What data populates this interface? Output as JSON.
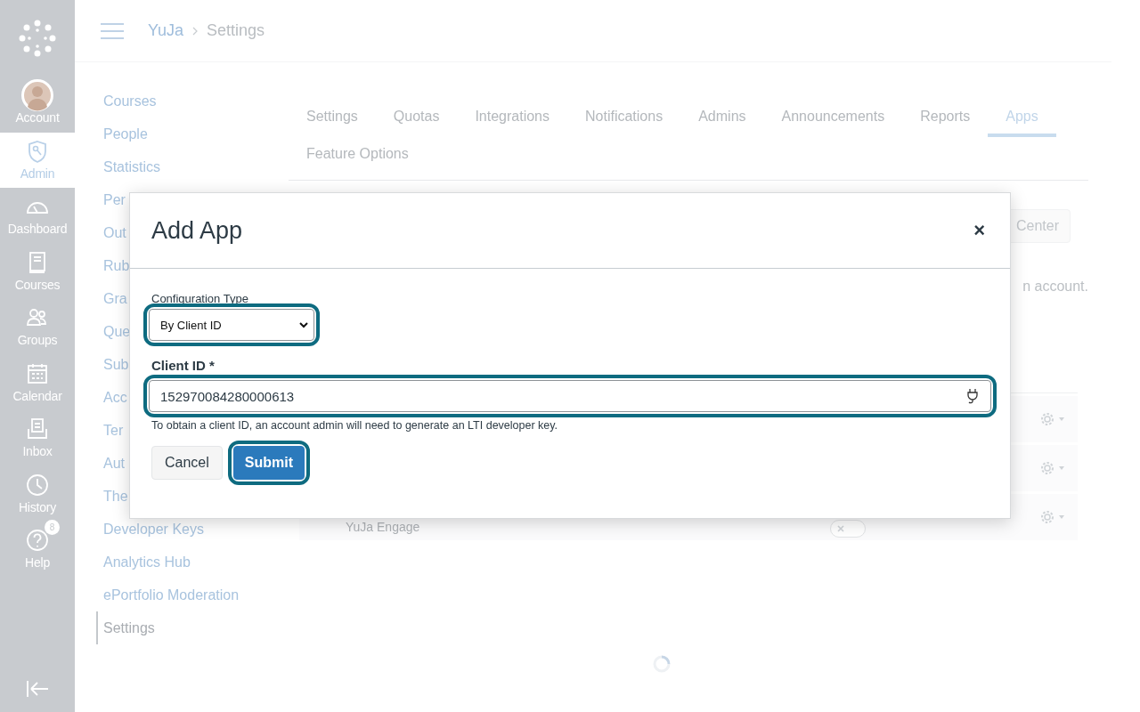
{
  "global_nav": {
    "items": [
      {
        "kind": "avatar",
        "label": "Account",
        "selected": false
      },
      {
        "kind": "shield",
        "label": "Admin",
        "selected": true
      },
      {
        "kind": "gauge",
        "label": "Dashboard",
        "selected": false
      },
      {
        "kind": "book",
        "label": "Courses",
        "selected": false
      },
      {
        "kind": "people",
        "label": "Groups",
        "selected": false
      },
      {
        "kind": "calendar",
        "label": "Calendar",
        "selected": false
      },
      {
        "kind": "inbox",
        "label": "Inbox",
        "selected": false
      },
      {
        "kind": "clock",
        "label": "History",
        "selected": false
      },
      {
        "kind": "help",
        "label": "Help",
        "selected": false,
        "badge": "8"
      }
    ]
  },
  "breadcrumb": [
    "YuJa",
    "Settings"
  ],
  "account_nav": {
    "items": [
      {
        "label": "Courses",
        "selected": false
      },
      {
        "label": "People",
        "selected": false
      },
      {
        "label": "Statistics",
        "selected": false
      },
      {
        "label": "Per",
        "selected": false
      },
      {
        "label": "Out",
        "selected": false
      },
      {
        "label": "Rub",
        "selected": false
      },
      {
        "label": "Gra",
        "selected": false
      },
      {
        "label": "Que",
        "selected": false
      },
      {
        "label": "Sub",
        "selected": false
      },
      {
        "label": "Acc",
        "selected": false
      },
      {
        "label": "Ter",
        "selected": false
      },
      {
        "label": "Aut",
        "selected": false
      },
      {
        "label": "The",
        "selected": false
      },
      {
        "label": "Developer Keys",
        "selected": false
      },
      {
        "label": "Analytics Hub",
        "selected": false
      },
      {
        "label": "ePortfolio Moderation",
        "selected": false
      },
      {
        "label": "Settings",
        "selected": true
      }
    ]
  },
  "tabs": [
    {
      "label": "Settings",
      "selected": false
    },
    {
      "label": "Quotas",
      "selected": false
    },
    {
      "label": "Integrations",
      "selected": false
    },
    {
      "label": "Notifications",
      "selected": false
    },
    {
      "label": "Admins",
      "selected": false
    },
    {
      "label": "Announcements",
      "selected": false
    },
    {
      "label": "Reports",
      "selected": false
    },
    {
      "label": "Apps",
      "selected": true
    },
    {
      "label": "Feature Options",
      "selected": false
    }
  ],
  "app_center_button": "Center",
  "intro_text": "n account.",
  "apps_table": {
    "rows": [
      {
        "kind": "covered"
      },
      {
        "kind": "covered"
      },
      {
        "kind": "app",
        "name": "YuJa Engage",
        "enabled": false
      }
    ]
  },
  "dialog": {
    "title": "Add App",
    "close": "×",
    "configuration_type": {
      "label": "Configuration Type",
      "value": "By Client ID",
      "highlighted": true
    },
    "client_id": {
      "label": "Client ID *",
      "value": "152970084280000613",
      "highlighted": true
    },
    "hint": "To obtain a client ID, an account admin will need to generate an LTI developer key.",
    "buttons": [
      {
        "label": "Cancel",
        "kind": "secondary",
        "highlighted": false
      },
      {
        "label": "Submit",
        "kind": "primary",
        "highlighted": true
      }
    ]
  }
}
